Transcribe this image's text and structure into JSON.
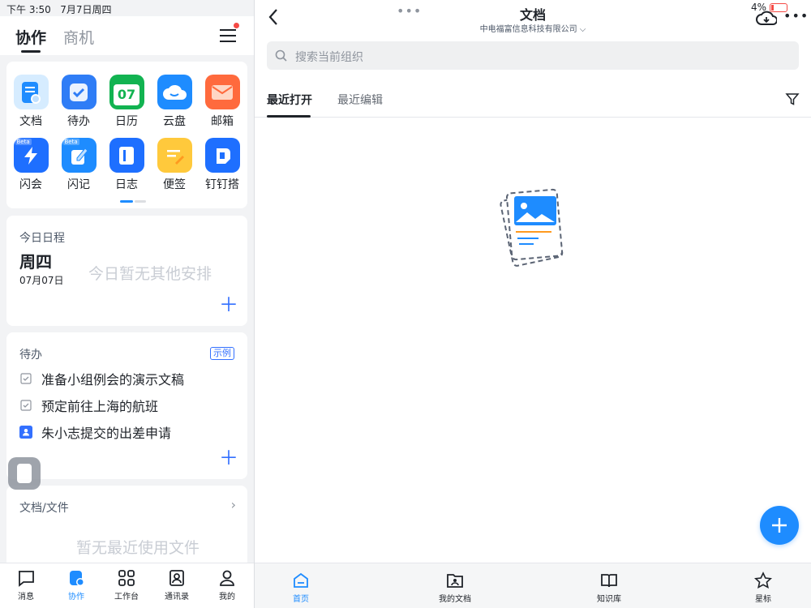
{
  "status": {
    "time": "下午 3:50",
    "date": "7月7日周四",
    "battery": "4%"
  },
  "left": {
    "tabs": [
      "协作",
      "商机"
    ],
    "apps": [
      {
        "label": "文档",
        "icon": "doc-icon"
      },
      {
        "label": "待办",
        "icon": "todo-icon"
      },
      {
        "label": "日历",
        "icon": "calendar-icon",
        "day": "07"
      },
      {
        "label": "云盘",
        "icon": "cloud-drive-icon"
      },
      {
        "label": "邮箱",
        "icon": "mail-icon"
      },
      {
        "label": "闪会",
        "icon": "flash-meeting-icon",
        "badge": "Beta"
      },
      {
        "label": "闪记",
        "icon": "flash-note-icon",
        "badge": "Beta"
      },
      {
        "label": "日志",
        "icon": "log-icon"
      },
      {
        "label": "便签",
        "icon": "sticky-note-icon"
      },
      {
        "label": "钉钉搭",
        "icon": "dingtalk-build-icon"
      }
    ],
    "schedule": {
      "title": "今日日程",
      "weekday": "周四",
      "date": "07月07日",
      "empty": "今日暂无其他安排"
    },
    "todo": {
      "title": "待办",
      "badge": "示例",
      "items": [
        "准备小组例会的演示文稿",
        "预定前往上海的航班",
        "朱小志提交的出差申请"
      ]
    },
    "docs": {
      "title": "文档/文件",
      "empty": "暂无最近使用文件"
    },
    "nav": [
      "消息",
      "协作",
      "工作台",
      "通讯录",
      "我的"
    ]
  },
  "right": {
    "title": "文档",
    "org": "中电福富信息科技有限公司",
    "search_placeholder": "搜索当前组织",
    "tabs": [
      "最近打开",
      "最近编辑"
    ],
    "nav": [
      "首页",
      "我的文档",
      "知识库",
      "星标"
    ]
  },
  "colors": {
    "accent": "#3370ff",
    "fab": "#1e8cff"
  }
}
